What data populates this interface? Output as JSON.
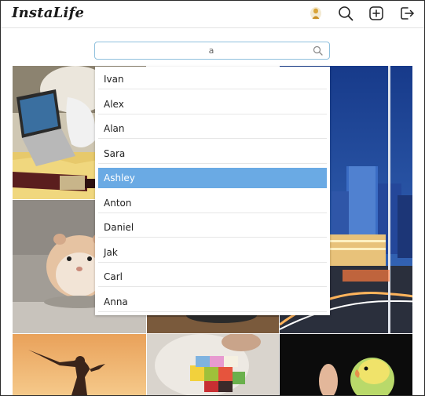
{
  "app": {
    "title": "InstaLife"
  },
  "header": {
    "icons": [
      "avatar-icon",
      "search-icon",
      "add-post-icon",
      "logout-icon"
    ]
  },
  "search": {
    "value": "a"
  },
  "dropdown": {
    "options": [
      "Ivan",
      "Alex",
      "Alan",
      "Sara",
      "Ashley",
      "Anton",
      "Daniel",
      "Jak",
      "Carl",
      "Anna"
    ],
    "selected": "Ashley"
  },
  "colors": {
    "selected_bg": "#6aaae4",
    "search_border": "#8fc0dd"
  },
  "feed": {
    "tiles": [
      "laptop-and-wine-photo",
      "hamster-photo",
      "city-skyscrapers-photo",
      "food-photo",
      "sunset-silhouette-photo",
      "colorful-cake-photo",
      "parrot-photo"
    ]
  }
}
